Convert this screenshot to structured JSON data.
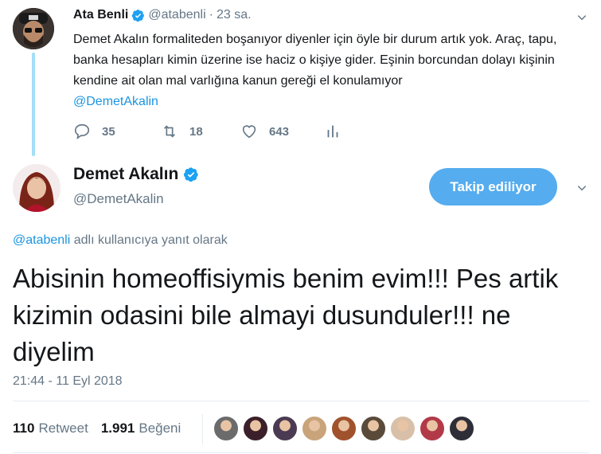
{
  "parent_tweet": {
    "author_name": "Ata Benli",
    "author_handle": "@atabenli",
    "separator": "·",
    "time": "23 sa.",
    "text": "Demet Akalın formaliteden boşanıyor diyenler için öyle bir durum artık yok. Araç, tapu, banka hesapları kimin üzerine ise haciz o kişiye gider. Eşinin borcundan dolayı kişinin kendine ait olan mal varlığına kanun gereği el konulamıyor",
    "mention": "@DemetAkalin",
    "actions": {
      "replies": "35",
      "retweets": "18",
      "likes": "643"
    }
  },
  "main_tweet": {
    "author_name": "Demet Akalın",
    "author_handle": "@DemetAkalin",
    "follow_button": "Takip ediliyor",
    "reply_to_handle": "@atabenli",
    "reply_to_suffix": " adlı kullanıcıya yanıt olarak",
    "text": "Abisinin homeoffisiymis benim evim!!! Pes artik kizimin odasini bile almayi dusunduler!!! ne diyelim",
    "timestamp": "21:44 - 11 Eyl 2018",
    "stats": {
      "retweets": "110",
      "retweets_label": "Retweet",
      "likes": "1.991",
      "likes_label": "Beğeni"
    }
  },
  "colors": {
    "accent": "#1b95e0",
    "follow_bg": "#55acee",
    "thread_line": "#a3dff8",
    "muted": "#657786",
    "verified": "#1da1f2"
  },
  "liker_avatars": [
    "#6b6b6b",
    "#3b1f2a",
    "#4a3b52",
    "#c9a47a",
    "#a0522d",
    "#5a4a3a",
    "#d8c0a8",
    "#b23a48",
    "#2e2e38"
  ]
}
